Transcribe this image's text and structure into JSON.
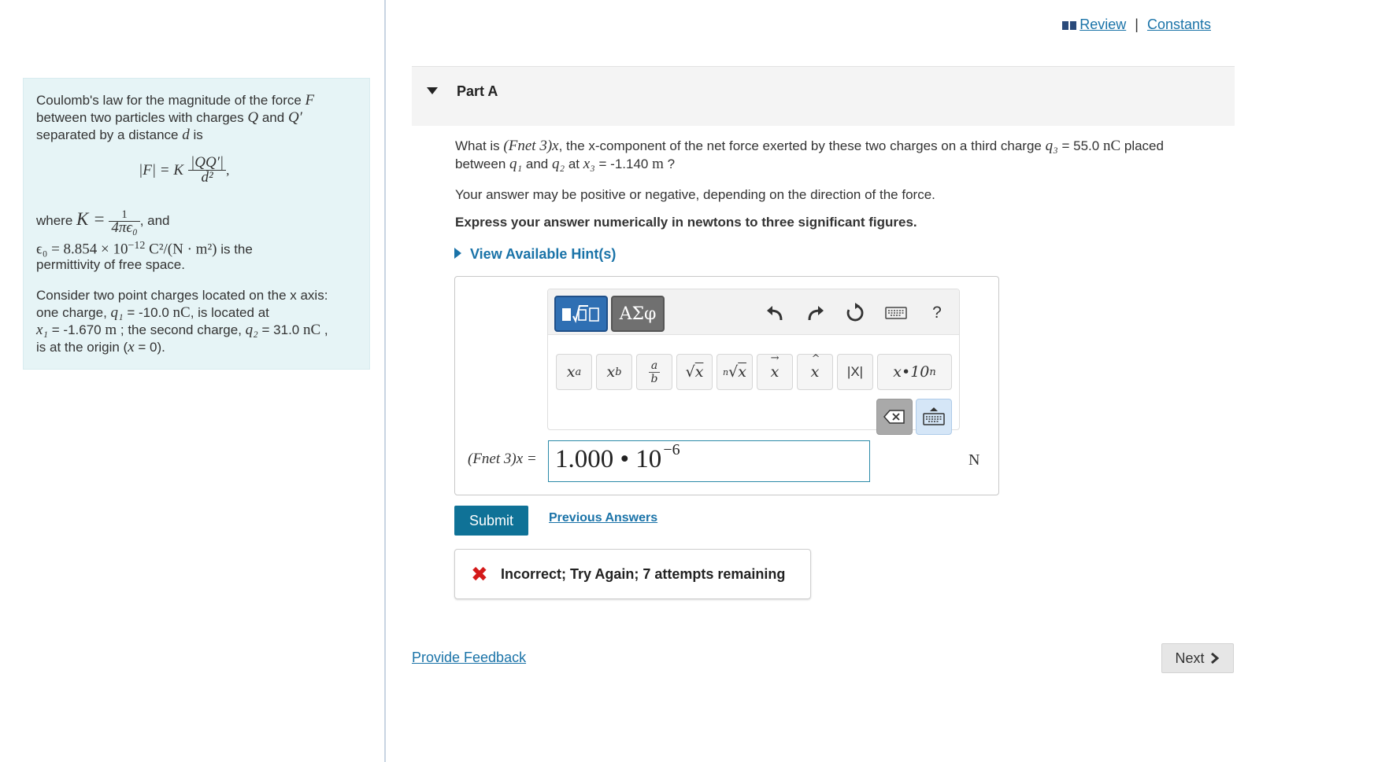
{
  "header": {
    "review_label": "Review",
    "separator": "|",
    "constants_label": "Constants"
  },
  "intro": {
    "line1_text": "Coulomb's law for the magnitude of the force",
    "line1_var": "F",
    "line2_a": "between two particles with charges",
    "line2_q": "Q",
    "line2_and": "and",
    "line2_qp": "Q′",
    "line3_a": "separated by a distance",
    "line3_d": "d",
    "line3_is": "is",
    "formula_lhs": "|F| = K",
    "formula_num": "|QQ′|",
    "formula_den": "d²",
    "formula_tail": ",",
    "where_text": "where",
    "where_k": "K =",
    "k_num": "1",
    "k_den": "4πϵ₀",
    "where_and": ", and",
    "eps_expr": "ϵ₀ = 8.854 × 10",
    "eps_exp": "−12",
    "eps_units": "C²/(N · m²)",
    "eps_tail": "is the",
    "line_perm": "permittivity of free space.",
    "p2_line1": "Consider two point charges located on the x axis:",
    "p2_line2_a": "one charge,",
    "p2_line2_var": "q₁",
    "p2_line2_val": "= -10.0",
    "p2_line2_unit": "nC",
    "p2_line2_b": ", is located at",
    "p2_line3_var": "x₁",
    "p2_line3_val": "= -1.670",
    "p2_line3_unit": "m",
    "p2_line3_b": "; the second charge,",
    "p2_line3_var2": "q₂",
    "p2_line3_val2": "= 31.0",
    "p2_line3_unit2": "nC",
    "p2_line3_c": ",",
    "p2_line4_a": "is at the origin (",
    "p2_line4_var": "x",
    "p2_line4_b": "= 0)."
  },
  "part": {
    "title": "Part A",
    "q_a": "What is",
    "q_var": "(Fnet 3)x",
    "q_b": ", the x-component of the net force exerted by these two charges on a third charge",
    "q_q3": "q₃",
    "q_q3val": "= 55.0",
    "q_q3unit": "nC",
    "q_c": "placed",
    "q2_a": "between",
    "q2_q1": "q₁",
    "q2_and": "and",
    "q2_q2": "q₂",
    "q2_at": "at",
    "q2_x3": "x₃",
    "q2_val": "= -1.140",
    "q2_unit": "m",
    "q2_end": "?",
    "note": "Your answer may be positive or negative, depending on the direction of the force.",
    "instruction": "Express your answer numerically in newtons to three significant figures.",
    "hint_label": "View Available Hint(s)"
  },
  "toolbar": {
    "symbols_label": "ΑΣφ",
    "help_label": "?",
    "buttons": [
      "xᵃ",
      "x_b",
      "a/b",
      "√x",
      "ⁿ√x",
      "x⃗",
      "x̂",
      "|X|",
      "x•10ⁿ"
    ],
    "icons": [
      "templates-icon",
      "undo-icon",
      "redo-icon",
      "reset-icon",
      "keyboard-icon",
      "help-icon",
      "backspace-icon",
      "keyboard-toggle-icon"
    ]
  },
  "answer": {
    "label": "(Fnet 3)x =",
    "mantissa": "1.000 • 10",
    "exponent": "−6",
    "unit": "N"
  },
  "actions": {
    "submit_label": "Submit",
    "previous_label": "Previous Answers",
    "feedback_text": "Incorrect; Try Again; 7 attempts remaining",
    "provide_feedback_label": "Provide Feedback",
    "next_label": "Next"
  },
  "colors": {
    "link": "#1a73a8",
    "submit_bg": "#0f7297",
    "intro_bg": "#e6f4f6",
    "error": "#d41a1a",
    "templates_bg": "#2f6fb3"
  }
}
